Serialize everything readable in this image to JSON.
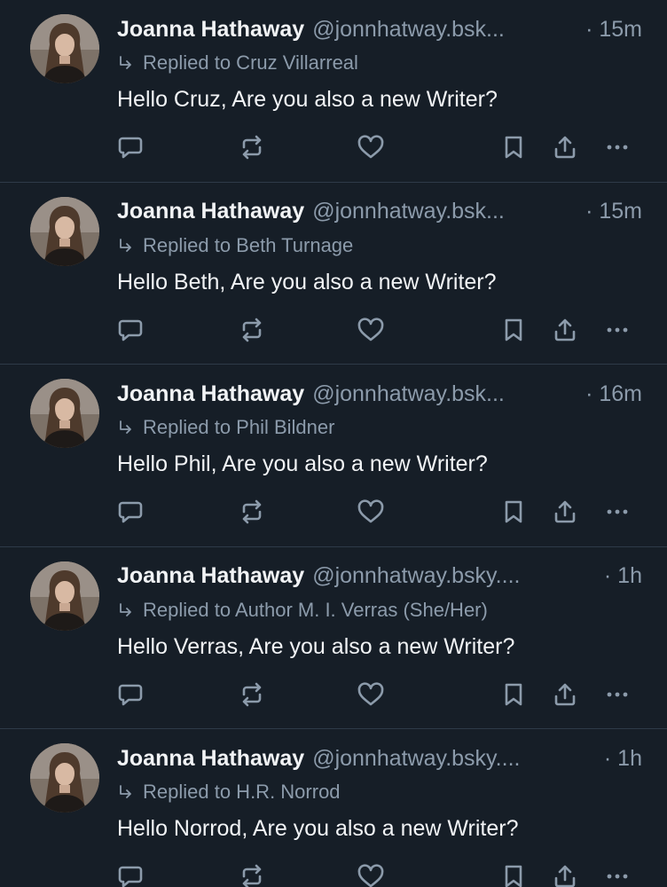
{
  "colors": {
    "background": "#161e27",
    "divider": "#2e3a48",
    "primary_text": "#f1f3f5",
    "secondary_text": "#8c9bab",
    "icon": "#8c9bab"
  },
  "icons": {
    "avatar": "profile-photo",
    "reply_indicator": "reply-arrow-icon",
    "actions": [
      "reply-icon",
      "repost-icon",
      "heart-icon",
      "bookmark-icon",
      "share-icon",
      "more-icon"
    ]
  },
  "posts": [
    {
      "author": "Joanna Hathaway",
      "handle": "@jonnhatway.bsk...",
      "time": "· 15m",
      "reply_to": "Replied to Cruz Villarreal",
      "text": "Hello Cruz, Are you also a new Writer?"
    },
    {
      "author": "Joanna Hathaway",
      "handle": "@jonnhatway.bsk...",
      "time": "· 15m",
      "reply_to": "Replied to Beth Turnage",
      "text": "Hello Beth, Are you also a new Writer?"
    },
    {
      "author": "Joanna Hathaway",
      "handle": "@jonnhatway.bsk...",
      "time": "· 16m",
      "reply_to": "Replied to Phil Bildner",
      "text": "Hello Phil, Are you also a new Writer?"
    },
    {
      "author": "Joanna Hathaway",
      "handle": "@jonnhatway.bsky....",
      "time": "· 1h",
      "reply_to": "Replied to Author M. I. Verras (She/Her)",
      "text": "Hello Verras, Are you also a new Writer?"
    },
    {
      "author": "Joanna Hathaway",
      "handle": "@jonnhatway.bsky....",
      "time": "· 1h",
      "reply_to": "Replied to H.R. Norrod",
      "text": "Hello Norrod, Are you also a new Writer?"
    }
  ]
}
